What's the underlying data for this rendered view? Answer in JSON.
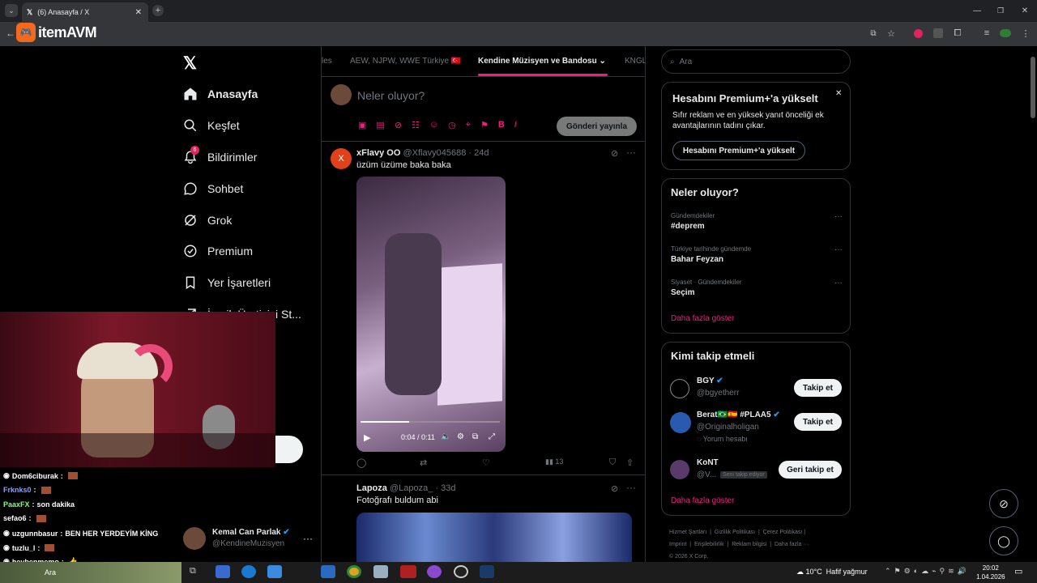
{
  "browser": {
    "tab_title": "(6) Anasayfa / X",
    "overlay_logo": "itemAVM"
  },
  "nav": {
    "items": [
      {
        "label": "Anasayfa",
        "icon": "home-icon"
      },
      {
        "label": "Keşfet",
        "icon": "search-icon"
      },
      {
        "label": "Bildirimler",
        "icon": "bell-icon",
        "badge": "6"
      },
      {
        "label": "Sohbet",
        "icon": "chat-icon"
      },
      {
        "label": "Grok",
        "icon": "grok-icon"
      },
      {
        "label": "Premium",
        "icon": "premium-icon"
      },
      {
        "label": "Yer İşaretleri",
        "icon": "bookmark-icon"
      },
      {
        "label": "İçerik Üreticisi St...",
        "icon": "creator-icon"
      }
    ],
    "account": {
      "name": "Kemal Can Parlak",
      "handle": "@KendineMuzisyen"
    }
  },
  "feed": {
    "tabs": [
      "les",
      "AEW, NJPW, WWE Türkiye 🇹🇷",
      "Kendine Müzisyen ve Bandosu",
      "KNGL"
    ],
    "composer": {
      "placeholder": "Neler oluyor?",
      "post_button": "Gönderi yayınla"
    },
    "tweets": [
      {
        "name": "xFlavy OO",
        "handle": "@Xflavy045688",
        "time": "24d",
        "text": "üzüm üzüme baka baka",
        "video_time": "0:04 / 0:11",
        "views": "13",
        "avatar_letter": "X"
      },
      {
        "name": "Lapoza",
        "handle": "@Lapoza_",
        "time": "33d",
        "text": "Fotoğrafı buldum abi"
      }
    ]
  },
  "right": {
    "search_placeholder": "Ara",
    "premium": {
      "title": "Hesabını Premium+'a yükselt",
      "body": "Sıfır reklam ve en yüksek yanıt önceliği ek avantajlarının tadını çıkar.",
      "button": "Hesabını Premium+'a yükselt"
    },
    "trends": {
      "title": "Neler oluyor?",
      "items": [
        {
          "context": "Gündemdekiler",
          "name": "#deprem"
        },
        {
          "context": "Türkiye tarihinde gündemde",
          "name": "Bahar Feyzan"
        },
        {
          "context": "Siyaset · Gündemdekiler",
          "name": "Seçim"
        }
      ],
      "more": "Daha fazla göster"
    },
    "follow": {
      "title": "Kimi takip etmeli",
      "items": [
        {
          "name": "BGY",
          "handle": "@bgyetherr",
          "button": "Takip et"
        },
        {
          "name": "Berat🇧🇷🇪🇸 #PLAA5",
          "handle": "@Originalholigan",
          "sub": "Yorum hesabı",
          "button": "Takip et"
        },
        {
          "name": "KoNT",
          "handle": "@V...",
          "badge": "Seni takip ediyor",
          "button": "Geri takip et"
        }
      ],
      "more": "Daha fazla göster"
    },
    "footer": [
      "Hizmet Şartları",
      "Gizlilik Politikası",
      "Çerez Politikası",
      "Imprint",
      "Erişilebilirlik",
      "Reklam bilgisi",
      "Daha fazla ···",
      "© 2026 X Corp."
    ]
  },
  "chat": [
    {
      "user": "Dom6ciburak",
      "msg": "",
      "color": "#ffffff"
    },
    {
      "user": "Frknks0",
      "msg": "",
      "color": "#8aa0ff"
    },
    {
      "user": "PaaxFX",
      "msg": "son dakika",
      "color": "#7fff7f"
    },
    {
      "user": "sefao6",
      "msg": "",
      "color": "#ffffff"
    },
    {
      "user": "uzgunnbasur",
      "msg": "BEN HER YERDEYİM KİNG",
      "color": "#ffffff"
    },
    {
      "user": "tuzlu_l",
      "msg": "",
      "color": "#ffffff"
    },
    {
      "user": "heybenmemo",
      "msg": "",
      "color": "#ffffff"
    }
  ],
  "taskbar": {
    "weather": "10°C",
    "weather_desc": "Hafif yağmur",
    "time": "20:02",
    "date": "1.04.2026",
    "search": "Ara"
  }
}
